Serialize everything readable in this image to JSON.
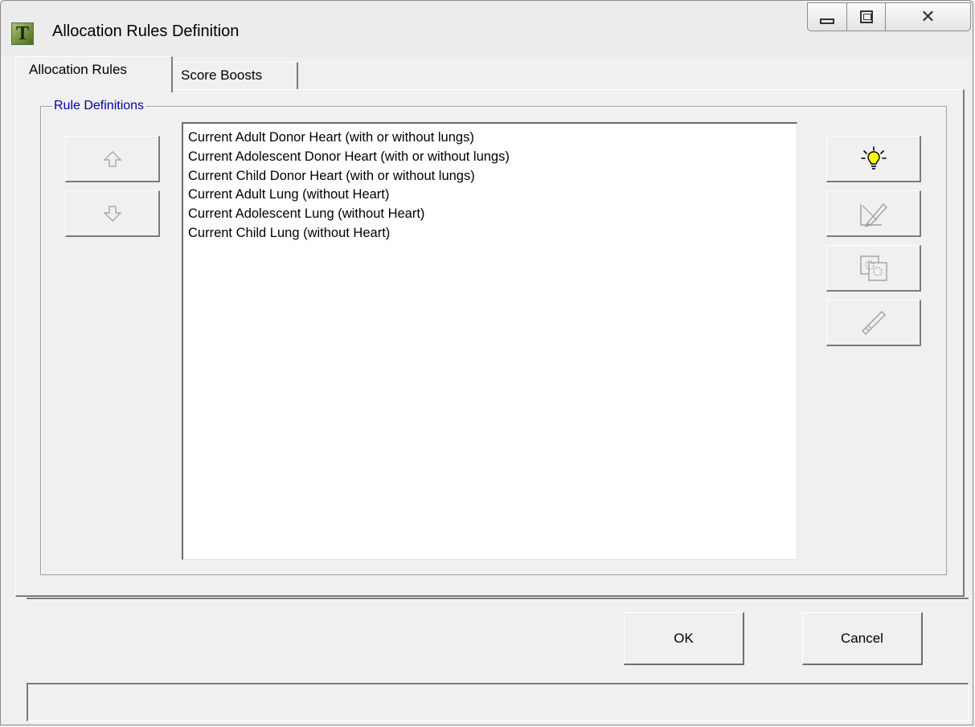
{
  "window": {
    "title": "Allocation Rules Definition",
    "app_icon_letter": "T",
    "controls": [
      "minimize-icon",
      "maximize-icon",
      "close-icon"
    ],
    "close_glyph": "✕"
  },
  "tabs": [
    {
      "label": "Allocation Rules",
      "active": true
    },
    {
      "label": "Score Boosts",
      "active": false
    }
  ],
  "rule_definitions": {
    "group_label": "Rule Definitions",
    "items": [
      "Current Adult Donor Heart (with or without lungs)",
      "Current Adolescent Donor Heart (with or without lungs)",
      "Current Child Donor Heart (with or without lungs)",
      "Current Adult Lung (without Heart)",
      "Current Adolescent Lung (without Heart)",
      "Current Child Lung (without Heart)"
    ],
    "move_buttons": [
      "arrow-up-icon",
      "arrow-down-icon"
    ],
    "action_buttons": [
      "lightbulb-icon",
      "edit-icon",
      "copy-icon",
      "delete-icon"
    ]
  },
  "footer": {
    "ok_label": "OK",
    "cancel_label": "Cancel",
    "status_text": ""
  },
  "colors": {
    "group_label": "#0000a8",
    "lightbulb": "#ffff00",
    "face": "#f0f0f0"
  }
}
